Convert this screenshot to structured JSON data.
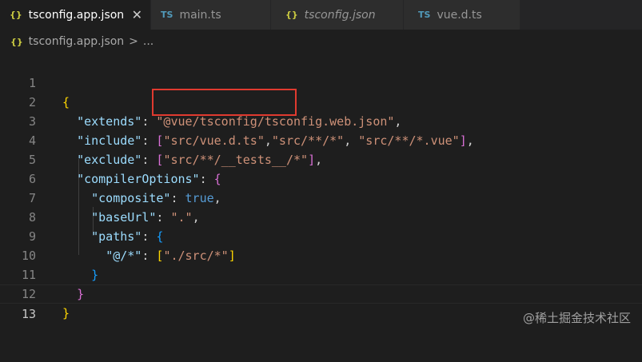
{
  "tabs": [
    {
      "icon": "{}",
      "label": "tsconfig.app.json",
      "active": true,
      "italic": false
    },
    {
      "icon": "TS",
      "label": "main.ts",
      "active": false,
      "italic": false
    },
    {
      "icon": "{}",
      "label": "tsconfig.json",
      "active": false,
      "italic": true
    },
    {
      "icon": "TS",
      "label": "vue.d.ts",
      "active": false,
      "italic": false
    }
  ],
  "close_glyph": "✕",
  "breadcrumb": {
    "icon": "{}",
    "file": "tsconfig.app.json",
    "separator": ">",
    "rest": "..."
  },
  "line_numbers": [
    "1",
    "2",
    "3",
    "4",
    "5",
    "6",
    "7",
    "8",
    "9",
    "10",
    "11",
    "12",
    "13"
  ],
  "code": {
    "l1_open": "{",
    "l2_key": "\"extends\"",
    "l2_colon": ": ",
    "l2_val": "\"@vue/tsconfig/tsconfig.web.json\"",
    "l2_comma": ",",
    "l3_key": "\"include\"",
    "l3_colon": ": ",
    "l3_open": "[",
    "l3_v1": "\"src/vue.d.ts\"",
    "l3_c1": ",",
    "l3_v2": "\"src/**/*\"",
    "l3_c2": ", ",
    "l3_v3": "\"src/**/*.vue\"",
    "l3_close": "]",
    "l3_comma": ",",
    "l4_key": "\"exclude\"",
    "l4_colon": ": ",
    "l4_open": "[",
    "l4_v1": "\"src/**/__tests__/*\"",
    "l4_close": "]",
    "l4_comma": ",",
    "l5_key": "\"compilerOptions\"",
    "l5_colon": ": ",
    "l5_open": "{",
    "l6_key": "\"composite\"",
    "l6_colon": ": ",
    "l6_val": "true",
    "l6_comma": ",",
    "l7_key": "\"baseUrl\"",
    "l7_colon": ": ",
    "l7_val": "\".\"",
    "l7_comma": ",",
    "l8_key": "\"paths\"",
    "l8_colon": ": ",
    "l8_open": "{",
    "l9_key": "\"@/*\"",
    "l9_colon": ": ",
    "l9_open": "[",
    "l9_val": "\"./src/*\"",
    "l9_close": "]",
    "l10_close": "}",
    "l11_close": "}",
    "l12_close": "}"
  },
  "watermark": "@稀土掘金技术社区",
  "colors": {
    "editor_bg": "#1e1e1e",
    "key": "#9cdcfe",
    "string": "#ce9178",
    "keyword": "#569cd6",
    "highlight_border": "#e03a2f"
  }
}
